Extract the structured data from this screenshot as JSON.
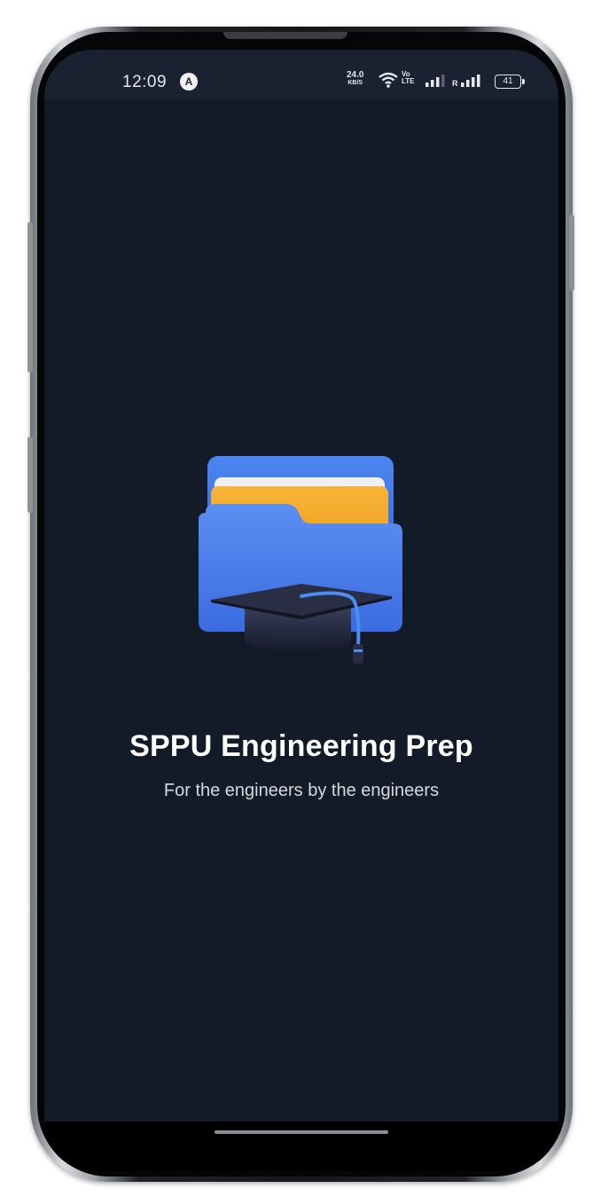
{
  "status_bar": {
    "time": "12:09",
    "notification_icon": "A",
    "net_speed_value": "24.0",
    "net_speed_unit": "KB/S",
    "volte_top": "Vo",
    "volte_bottom": "LTE",
    "battery_level": "41"
  },
  "splash": {
    "title": "SPPU Engineering Prep",
    "subtitle": "For the engineers by the engineers",
    "logo_icon": "folder-with-graduation-cap-icon"
  },
  "colors": {
    "screen_background": "#131a28",
    "status_bar_background": "#1a2232",
    "folder_blue": "#3f73e6",
    "folder_yellow": "#f5a623",
    "cap_navy": "#23263a"
  }
}
